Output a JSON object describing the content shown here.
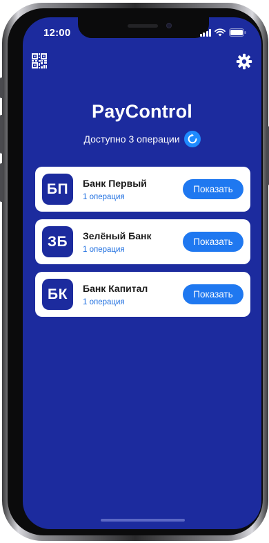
{
  "status_bar": {
    "time": "12:00"
  },
  "header": {
    "title": "PayControl",
    "subtitle": "Доступно 3 операции",
    "left_icon": "qr-code-icon",
    "right_icon": "gear-icon",
    "refresh_icon": "refresh-icon"
  },
  "banks": [
    {
      "logo": "БП",
      "name": "Банк Первый",
      "operations": "1 операция",
      "button_label": "Показать"
    },
    {
      "logo": "ЗБ",
      "name": "Зелёный Банк",
      "operations": "1 операция",
      "button_label": "Показать"
    },
    {
      "logo": "БК",
      "name": "Банк Капитал",
      "operations": "1 операция",
      "button_label": "Показать"
    }
  ],
  "colors": {
    "background": "#1c2b9e",
    "card": "#ffffff",
    "accent": "#1f78f0",
    "link": "#1f6fe0"
  }
}
